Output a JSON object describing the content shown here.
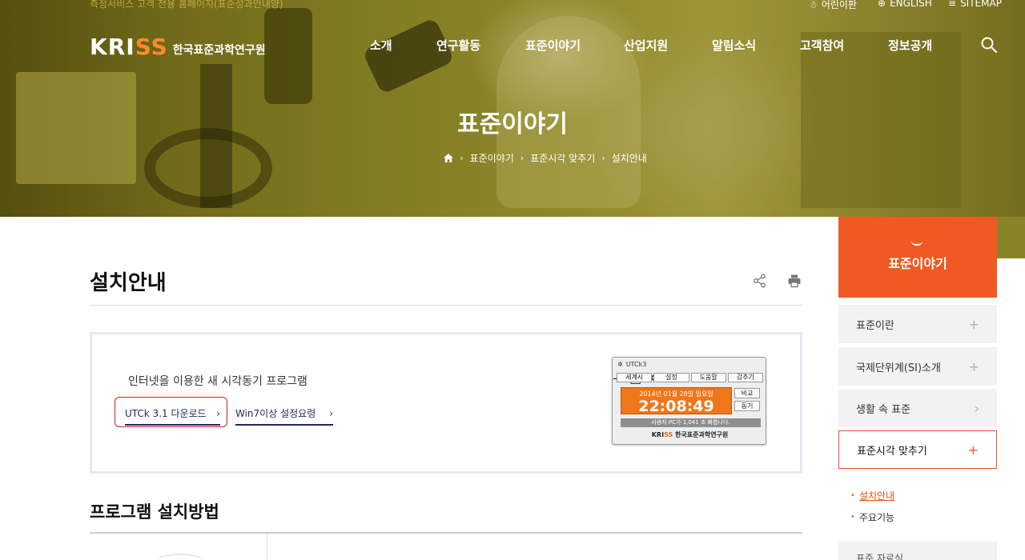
{
  "top": {
    "notice": "측정서비스 고객 전용 홈페이지(표준성과안내양)",
    "util": [
      {
        "label": "어린이판",
        "icon": "child-icon"
      },
      {
        "label": "ENGLISH",
        "icon": "globe-icon"
      },
      {
        "label": "SITEMAP",
        "icon": "menu-icon"
      }
    ]
  },
  "logo": {
    "mark_a": "KRI",
    "mark_b": "SS",
    "text": "한국표준과학연구원"
  },
  "gnb": [
    "소개",
    "연구활동",
    "표준이야기",
    "산업지원",
    "알림소식",
    "고객참여",
    "정보공개"
  ],
  "hero": {
    "title": "표준이야기",
    "breadcrumb": [
      "표준이야기",
      "표준시각 맞추기",
      "설치안내"
    ]
  },
  "content": {
    "title": "설치안내",
    "intro": "인터넷을 이용한 새 시각동기 프로그램",
    "links": [
      "UTCk 3.1 다운로드",
      "Win7이상 설정요령"
    ],
    "arrow": "›",
    "section_title": "프로그램 설치방법"
  },
  "utck": {
    "window_title": "UTCk3",
    "menu": [
      "세계시",
      "설정",
      "도움말",
      "감추기"
    ],
    "date": "2014년 01월 28일 일요일",
    "time": "22:08:49",
    "btn_compare": "비교",
    "btn_sync": "동기",
    "status": "사용자 PC가 1,041 초 빠릅니다.",
    "brand_a": "KRI",
    "brand_b": "SS",
    "brand_c": "한국표준과학연구원"
  },
  "sidebar": {
    "title": "표준이야기",
    "items": [
      {
        "label": "표준이란",
        "icon": "+"
      },
      {
        "label": "국제단위계(SI)소개",
        "icon": "+"
      },
      {
        "label": "생활 속 표준",
        "icon": "›"
      },
      {
        "label": "표준시각 맞추기",
        "icon": "+"
      }
    ],
    "subitems": [
      "설치안내",
      "주요기능"
    ],
    "next_item": "표준 자료실"
  }
}
